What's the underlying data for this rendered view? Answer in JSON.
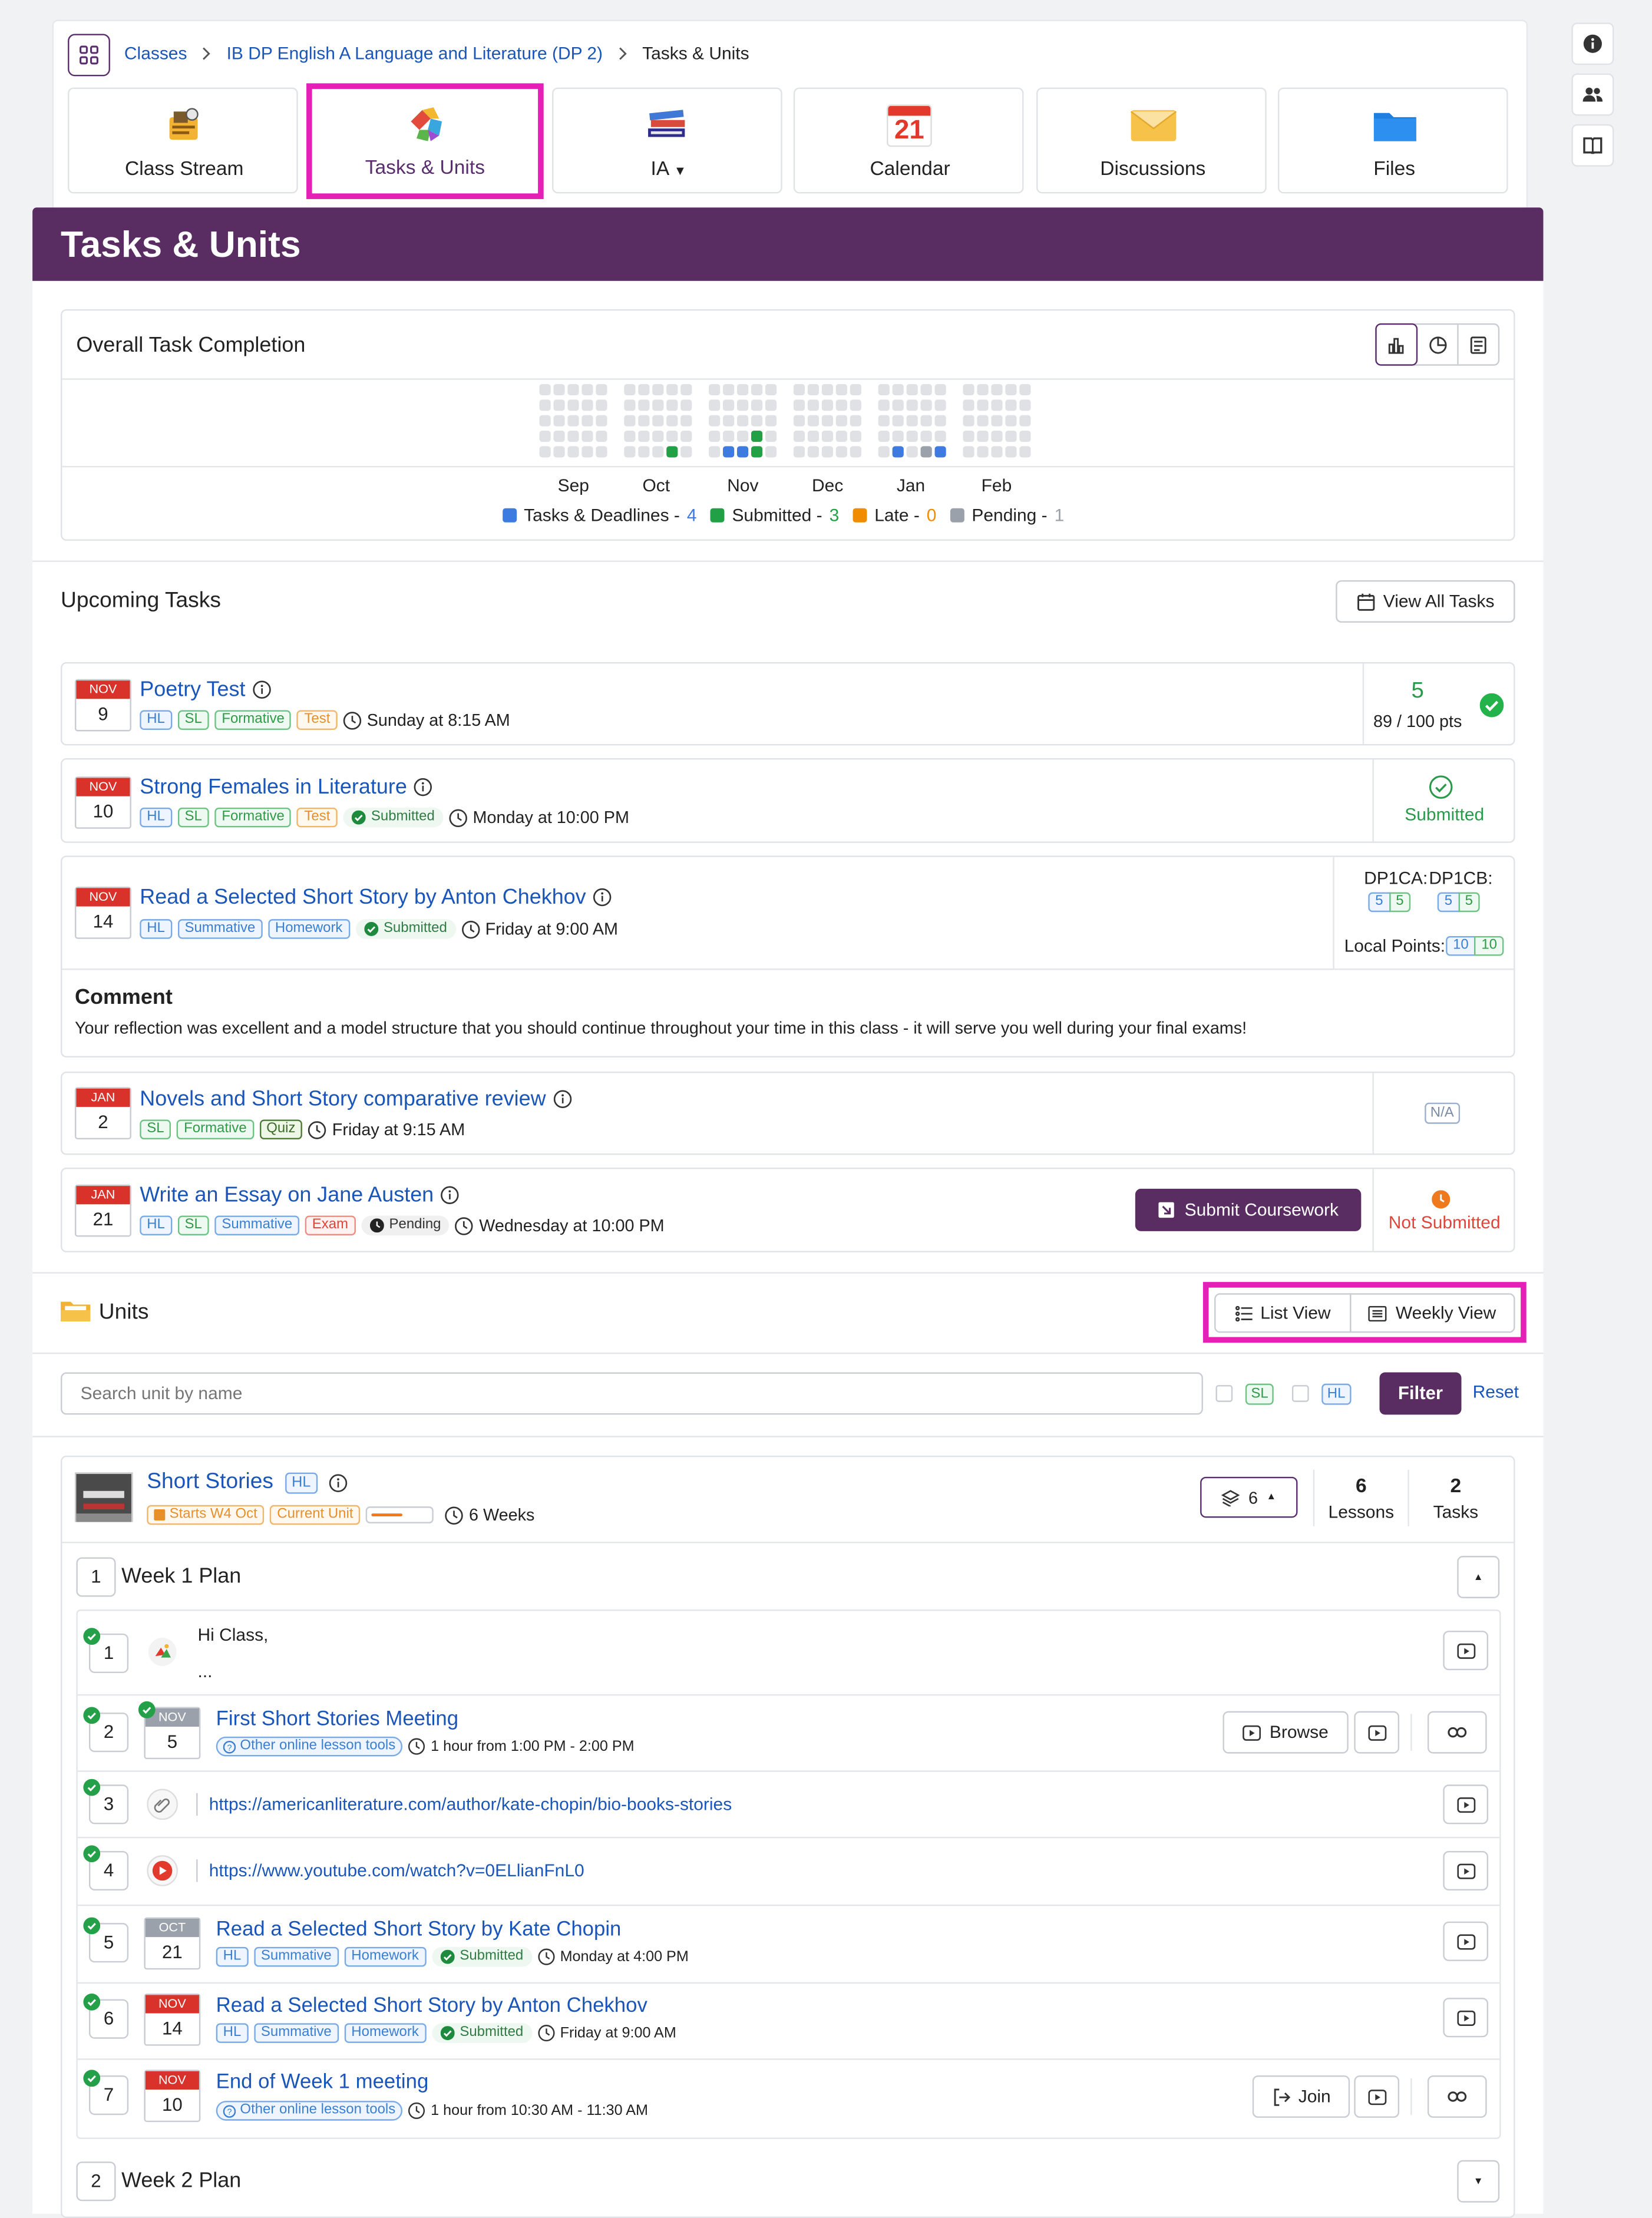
{
  "breadcrumb": {
    "items": [
      "Classes",
      "IB DP English A Language and Literature (DP 2)",
      "Tasks & Units"
    ]
  },
  "nav_tabs": [
    {
      "label": "Class Stream",
      "icon": "stream-icon"
    },
    {
      "label": "Tasks & Units",
      "icon": "puzzle-icon"
    },
    {
      "label": "IA",
      "icon": "books-icon"
    },
    {
      "label": "Calendar",
      "icon": "calendar-icon",
      "day": "21"
    },
    {
      "label": "Discussions",
      "icon": "envelope-icon"
    },
    {
      "label": "Files",
      "icon": "folder-icon"
    }
  ],
  "page_title": "Tasks & Units",
  "completion": {
    "title": "Overall Task Completion",
    "months": [
      "Sep",
      "Oct",
      "Nov",
      "Dec",
      "Jan",
      "Feb"
    ],
    "legend": [
      {
        "label": "Tasks & Deadlines",
        "count": "4",
        "color": "#3d7be0"
      },
      {
        "label": "Submitted",
        "count": "3",
        "color": "#22a045"
      },
      {
        "label": "Late",
        "count": "0",
        "color": "#f08c00"
      },
      {
        "label": "Pending",
        "count": "1",
        "color": "#9aa1aa"
      }
    ],
    "colors": {
      "empty": "#dfe1e5",
      "task": "#3d7be0",
      "submitted": "#22a045",
      "pending": "#9aa1aa"
    }
  },
  "upcoming": {
    "title": "Upcoming Tasks",
    "view_all": "View All Tasks",
    "tasks": [
      {
        "month": "NOV",
        "day": "9",
        "title": "Poetry Test",
        "tags": [
          "HL",
          "SL",
          "Formative",
          "Test"
        ],
        "due": "Sunday at 8:15 AM",
        "score": "5",
        "points": "89 / 100 pts"
      },
      {
        "month": "NOV",
        "day": "10",
        "title": "Strong Females in Literature",
        "tags": [
          "HL",
          "SL",
          "Formative",
          "Test"
        ],
        "status": "Submitted",
        "due": "Monday at 10:00 PM",
        "right": "Submitted"
      },
      {
        "month": "NOV",
        "day": "14",
        "title": "Read a Selected Short Story by Anton Chekhov",
        "tags": [
          "HL",
          "Summative",
          "Homework"
        ],
        "status": "Submitted",
        "due": "Friday at 9:00 AM",
        "crit1": "DP1CA:",
        "crit2": "DP1CB:",
        "crit_vals": [
          "5",
          "5",
          "5",
          "5"
        ],
        "local_label": "Local Points:",
        "local_vals": [
          "10",
          "10"
        ],
        "comment_title": "Comment",
        "comment": "Your reflection was excellent and a model structure that you should continue throughout your time in this class - it will serve you well during your final exams!"
      },
      {
        "month": "JAN",
        "day": "2",
        "title": "Novels and Short Story comparative review",
        "tags": [
          "SL",
          "Formative",
          "Quiz"
        ],
        "due": "Friday at 9:15 AM",
        "right": "N/A"
      },
      {
        "month": "JAN",
        "day": "21",
        "title": "Write an Essay on Jane Austen",
        "tags": [
          "HL",
          "SL",
          "Summative",
          "Exam"
        ],
        "status": "Pending",
        "due": "Wednesday at 10:00 PM",
        "button": "Submit Coursework",
        "right": "Not Submitted"
      }
    ]
  },
  "units": {
    "title": "Units",
    "list_view": "List View",
    "weekly_view": "Weekly View",
    "search_placeholder": "Search unit by name",
    "filter_sl": "SL",
    "filter_hl": "HL",
    "filter_btn": "Filter",
    "reset": "Reset",
    "unit": {
      "title": "Short Stories",
      "level": "HL",
      "starts": "Starts W4 Oct",
      "current": "Current Unit",
      "duration": "6 Weeks",
      "layers": "6",
      "lessons_n": "6",
      "lessons_l": "Lessons",
      "tasks_n": "2",
      "tasks_l": "Tasks",
      "progress": 0.55
    },
    "weeks": [
      {
        "n": "1",
        "label": "Week 1 Plan"
      },
      {
        "n": "2",
        "label": "Week 2 Plan"
      }
    ],
    "items": [
      {
        "n": "1",
        "text1": "Hi Class,",
        "text2": "..."
      },
      {
        "n": "2",
        "month": "NOV",
        "day": "5",
        "title": "First Short Stories Meeting",
        "tool": "Other online lesson tools",
        "time": "1 hour from 1:00 PM - 2:00 PM",
        "btn": "Browse"
      },
      {
        "n": "3",
        "url": "https://americanliterature.com/author/kate-chopin/bio-books-stories"
      },
      {
        "n": "4",
        "url": "https://www.youtube.com/watch?v=0ELlianFnL0"
      },
      {
        "n": "5",
        "month": "OCT",
        "day": "21",
        "title": "Read a Selected Short Story by Kate Chopin",
        "tags": [
          "HL",
          "Summative",
          "Homework"
        ],
        "status": "Submitted",
        "due": "Monday at 4:00 PM"
      },
      {
        "n": "6",
        "month": "NOV",
        "day": "14",
        "title": "Read a Selected Short Story by Anton Chekhov",
        "tags": [
          "HL",
          "Summative",
          "Homework"
        ],
        "status": "Submitted",
        "due": "Friday at 9:00 AM"
      },
      {
        "n": "7",
        "month": "NOV",
        "day": "10",
        "title": "End of Week 1 meeting",
        "tool": "Other online lesson tools",
        "time": "1 hour from 10:30 AM - 11:30 AM",
        "btn": "Join"
      }
    ]
  }
}
